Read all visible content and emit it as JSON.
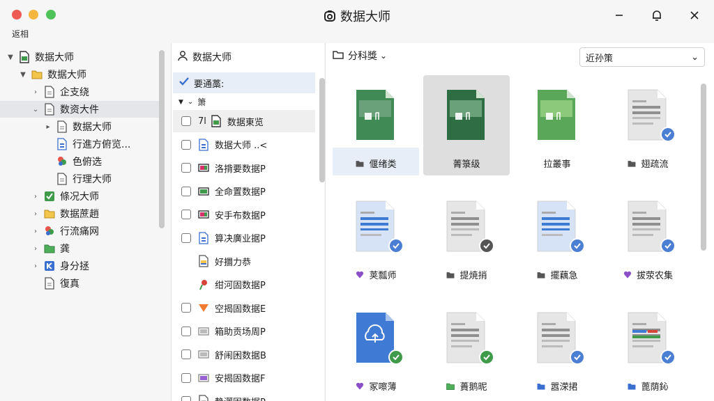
{
  "titlebar": {
    "title": "数据大师",
    "menu_label": "返相"
  },
  "tree": {
    "items": [
      {
        "label": "数据大师",
        "chevron": "▼",
        "icon": "sheet-green",
        "indent": 0
      },
      {
        "label": "数据大师",
        "chevron": "▼",
        "icon": "folder-yellow",
        "indent": 1
      },
      {
        "label": "企支绕",
        "chevron": "›",
        "icon": "doc-grey",
        "indent": 2
      },
      {
        "label": "数资大件",
        "chevron": "⌄",
        "icon": "doc-grey",
        "indent": 2,
        "selected": true
      },
      {
        "label": "数据大师",
        "chevron": "▸",
        "icon": "doc-grey",
        "indent": 3
      },
      {
        "label": "行進方俯览...",
        "chevron": "",
        "icon": "doc-blue",
        "indent": 3
      },
      {
        "label": "色俯选",
        "chevron": "",
        "icon": "multi-color",
        "indent": 3
      },
      {
        "label": "行理大师",
        "chevron": "",
        "icon": "doc-grey",
        "indent": 3
      },
      {
        "label": "條况大师",
        "chevron": "›",
        "icon": "check-green",
        "indent": 2
      },
      {
        "label": "数据蔗趙",
        "chevron": "›",
        "icon": "folder-yellow",
        "indent": 2
      },
      {
        "label": "行流痛网",
        "chevron": "›",
        "icon": "multi-color",
        "indent": 2
      },
      {
        "label": "龚",
        "chevron": "›",
        "icon": "folder-green",
        "indent": 2
      },
      {
        "label": "身分拯",
        "chevron": "›",
        "icon": "k-blue",
        "indent": 2
      },
      {
        "label": "復真",
        "chevron": "",
        "icon": "doc-grey",
        "indent": 2
      }
    ]
  },
  "files": {
    "header": "数据大师",
    "group_label": "要通藁:",
    "subgroup_label": "箫",
    "rows": [
      {
        "prefix": "7l",
        "label": "数据東览",
        "icon": "sheet-green",
        "checkbox": true,
        "selected": true
      },
      {
        "prefix": "",
        "label": "数据大师 ..<",
        "icon": "doc-blue",
        "checkbox": true
      },
      {
        "prefix": "",
        "label": "洛揹要数据P",
        "icon": "slide-multi",
        "checkbox": true
      },
      {
        "prefix": "",
        "label": "全命置数据P",
        "icon": "slide-green",
        "checkbox": true
      },
      {
        "prefix": "",
        "label": "安手布数据P",
        "icon": "slide-multi",
        "checkbox": true
      },
      {
        "prefix": "",
        "label": "算决廣业据P",
        "icon": "doc-blue",
        "checkbox": true
      },
      {
        "prefix": "",
        "label": "好攌力恭",
        "icon": "doc-yellow",
        "checkbox": false
      },
      {
        "prefix": "",
        "label": "绀河固数据P",
        "icon": "pin-red",
        "checkbox": false
      },
      {
        "prefix": "",
        "label": "空揭固数据E",
        "icon": "tri-orange",
        "checkbox": true
      },
      {
        "prefix": "",
        "label": "箱助贡场周P",
        "icon": "slide-grey",
        "checkbox": true
      },
      {
        "prefix": "",
        "label": "舒闹困数据B",
        "icon": "slide-grey",
        "checkbox": true
      },
      {
        "prefix": "",
        "label": "安揭固数据F",
        "icon": "slide-purple",
        "checkbox": true
      },
      {
        "prefix": "",
        "label": "静灑固数据P",
        "icon": "doc-grey",
        "checkbox": true
      }
    ]
  },
  "grid": {
    "breadcrumb": "分科獎",
    "sort_value": "近孙策",
    "tiles": [
      {
        "caption": "偃绪类",
        "thumb": "image",
        "badge": "",
        "cap_icon": "folder-grey",
        "state": "highlight"
      },
      {
        "caption": "菁箓级",
        "thumb": "image-dark",
        "badge": "",
        "cap_icon": "",
        "state": "selected"
      },
      {
        "caption": "拉叢事",
        "thumb": "image-green",
        "badge": "",
        "cap_icon": "",
        "state": ""
      },
      {
        "caption": "翅疏流",
        "thumb": "doc-grey",
        "badge": "blue",
        "cap_icon": "folder-grey",
        "state": ""
      },
      {
        "caption": "荚瓢师",
        "thumb": "doc-blue",
        "badge": "blue",
        "cap_icon": "heart-purple",
        "state": ""
      },
      {
        "caption": "提焼捎",
        "thumb": "doc-grey",
        "badge": "dark",
        "cap_icon": "folder-grey",
        "state": ""
      },
      {
        "caption": "擺藕急",
        "thumb": "doc-blue",
        "badge": "blue",
        "cap_icon": "folder-grey",
        "state": ""
      },
      {
        "caption": "拔荥农集",
        "thumb": "doc-grey",
        "badge": "blue",
        "cap_icon": "heart-purple",
        "state": ""
      },
      {
        "caption": "冢嚓薄",
        "thumb": "doc-blue-upload",
        "badge": "green",
        "cap_icon": "heart-purple",
        "state": ""
      },
      {
        "caption": "蕢鹅昵",
        "thumb": "doc-grey",
        "badge": "green",
        "cap_icon": "folder-green",
        "state": ""
      },
      {
        "caption": "嚣溁捃",
        "thumb": "doc-grey",
        "badge": "blue",
        "cap_icon": "folder-blue",
        "state": ""
      },
      {
        "caption": "蓖荫鈊",
        "thumb": "doc-color",
        "badge": "blue",
        "cap_icon": "folder-blue",
        "state": ""
      }
    ]
  },
  "colors": {
    "accent": "#4a7fd4",
    "green": "#3f9a4a",
    "selection": "#e4e6ea",
    "highlight": "#e8eef7"
  }
}
